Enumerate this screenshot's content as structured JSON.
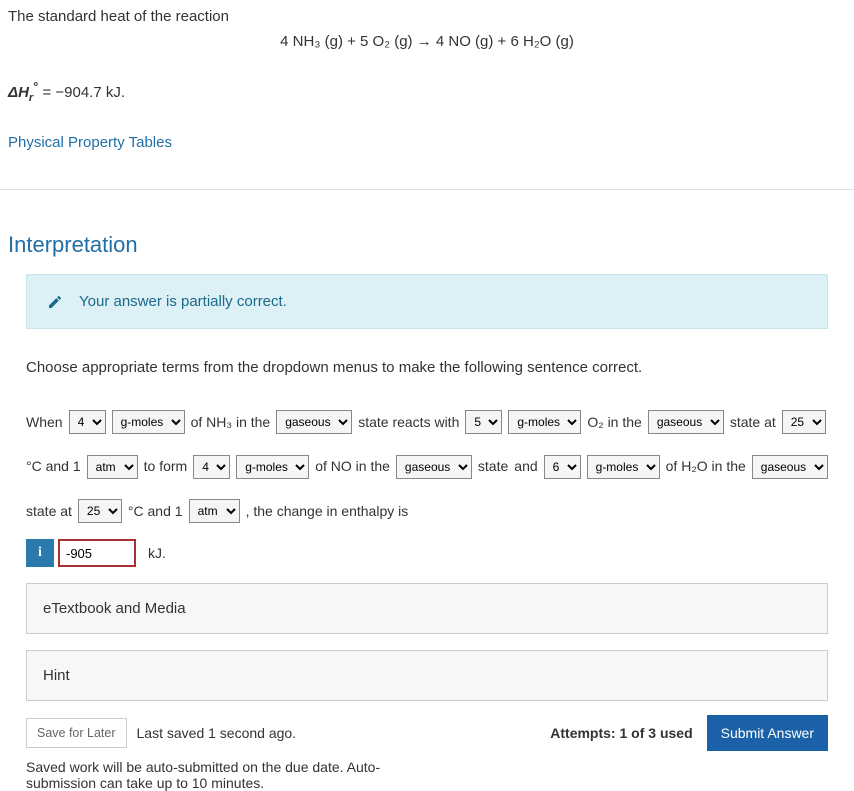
{
  "intro": "The standard heat of the reaction",
  "equation": "4 NH₃ (g) + 5 O₂ (g) → 4 NO (g) + 6 H₂O (g)",
  "delta_h_prefix": "ΔH",
  "delta_h_sub": "r",
  "delta_h_value": " = −904.7 kJ.",
  "link_tables": "Physical Property Tables",
  "section_title": "Interpretation",
  "alert_text": "Your answer is partially correct.",
  "instruction": "Choose appropriate terms from the dropdown menus to make the following sentence correct.",
  "txt": {
    "when": "When",
    "of_nh3_in_the": "of NH₃ in the",
    "state_reacts_with": "state reacts with",
    "o2_in_the": "O₂ in the",
    "state_at": "state at",
    "deg_c_and_1": "°C and 1",
    "to_form": "to form",
    "of_no_in_the": "of NO in the",
    "state": "state",
    "and": "and",
    "of_h2o_in_the": "of H₂O in the",
    "change_enthalpy": ", the change in enthalpy is",
    "kj": "kJ."
  },
  "sel": {
    "nh3_qty": "4",
    "nh3_unit": "g-moles",
    "nh3_phase": "gaseous",
    "o2_qty": "5",
    "o2_unit": "g-moles",
    "o2_phase": "gaseous",
    "o2_temp": "25",
    "o2_press": "atm",
    "no_qty": "4",
    "no_unit": "g-moles",
    "no_phase": "gaseous",
    "h2o_qty": "6",
    "h2o_unit": "g-moles",
    "h2o_phase": "gaseous",
    "h2o_temp": "25",
    "h2o_press": "atm"
  },
  "answer_value": "-905",
  "panel_etextbook": "eTextbook and Media",
  "panel_hint": "Hint",
  "save_for_later": "Save for Later",
  "last_saved": "Last saved 1 second ago.",
  "attempts": "Attempts: 1 of 3 used",
  "submit": "Submit Answer",
  "auto_submit": "Saved work will be auto-submitted on the due date. Auto-submission can take up to 10 minutes."
}
